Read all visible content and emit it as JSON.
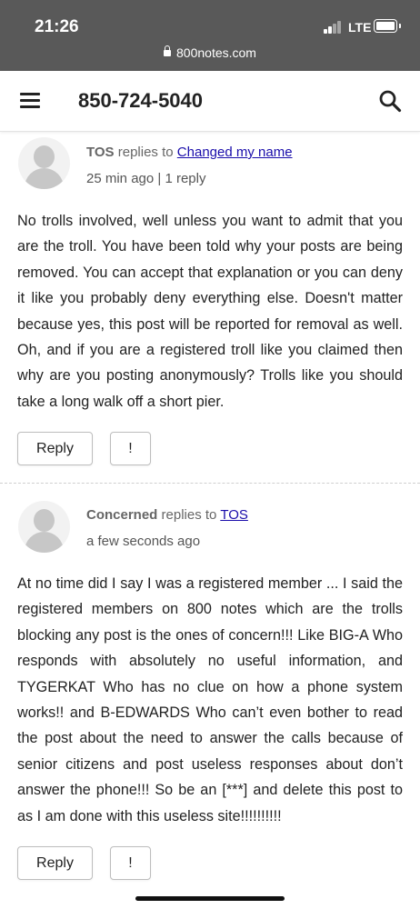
{
  "status_bar": {
    "time": "21:26",
    "network": "LTE"
  },
  "browser": {
    "url": "800notes.com"
  },
  "header": {
    "title": "850-724-5040"
  },
  "posts": [
    {
      "author": "TOS",
      "replies_to_text": "replies to",
      "replies_to": "Changed my name",
      "meta": "25 min ago | 1 reply",
      "text": "No trolls involved, well unless you want to admit that you are the troll. You have been told why your posts are being removed. You can accept that explanation or you can deny it like you probably deny everything else. Doesn't matter because yes, this post will be reported for removal as well. Oh, and if you are a registered troll like you claimed then why are you posting anonymously? Trolls like you should take a long walk off a short pier.",
      "reply_label": "Reply",
      "report_label": "!"
    },
    {
      "author": "Concerned",
      "replies_to_text": "replies to",
      "replies_to": "TOS",
      "meta": "a few seconds ago",
      "text": "At no time did I say I was a registered member ... I said the registered members on 800 notes which are the trolls blocking any post is the ones of concern!!! Like BIG-A Who responds with absolutely no useful information, and TYGERKAT Who has no clue on how a phone system works!! and B-EDWARDS Who can’t even bother to read the post about the need to answer the calls because of senior citizens and post useless responses about don’t answer the phone!!! So be an [***] and delete this post to as I am done with this useless site!!!!!!!!!!",
      "reply_label": "Reply",
      "report_label": "!"
    }
  ]
}
